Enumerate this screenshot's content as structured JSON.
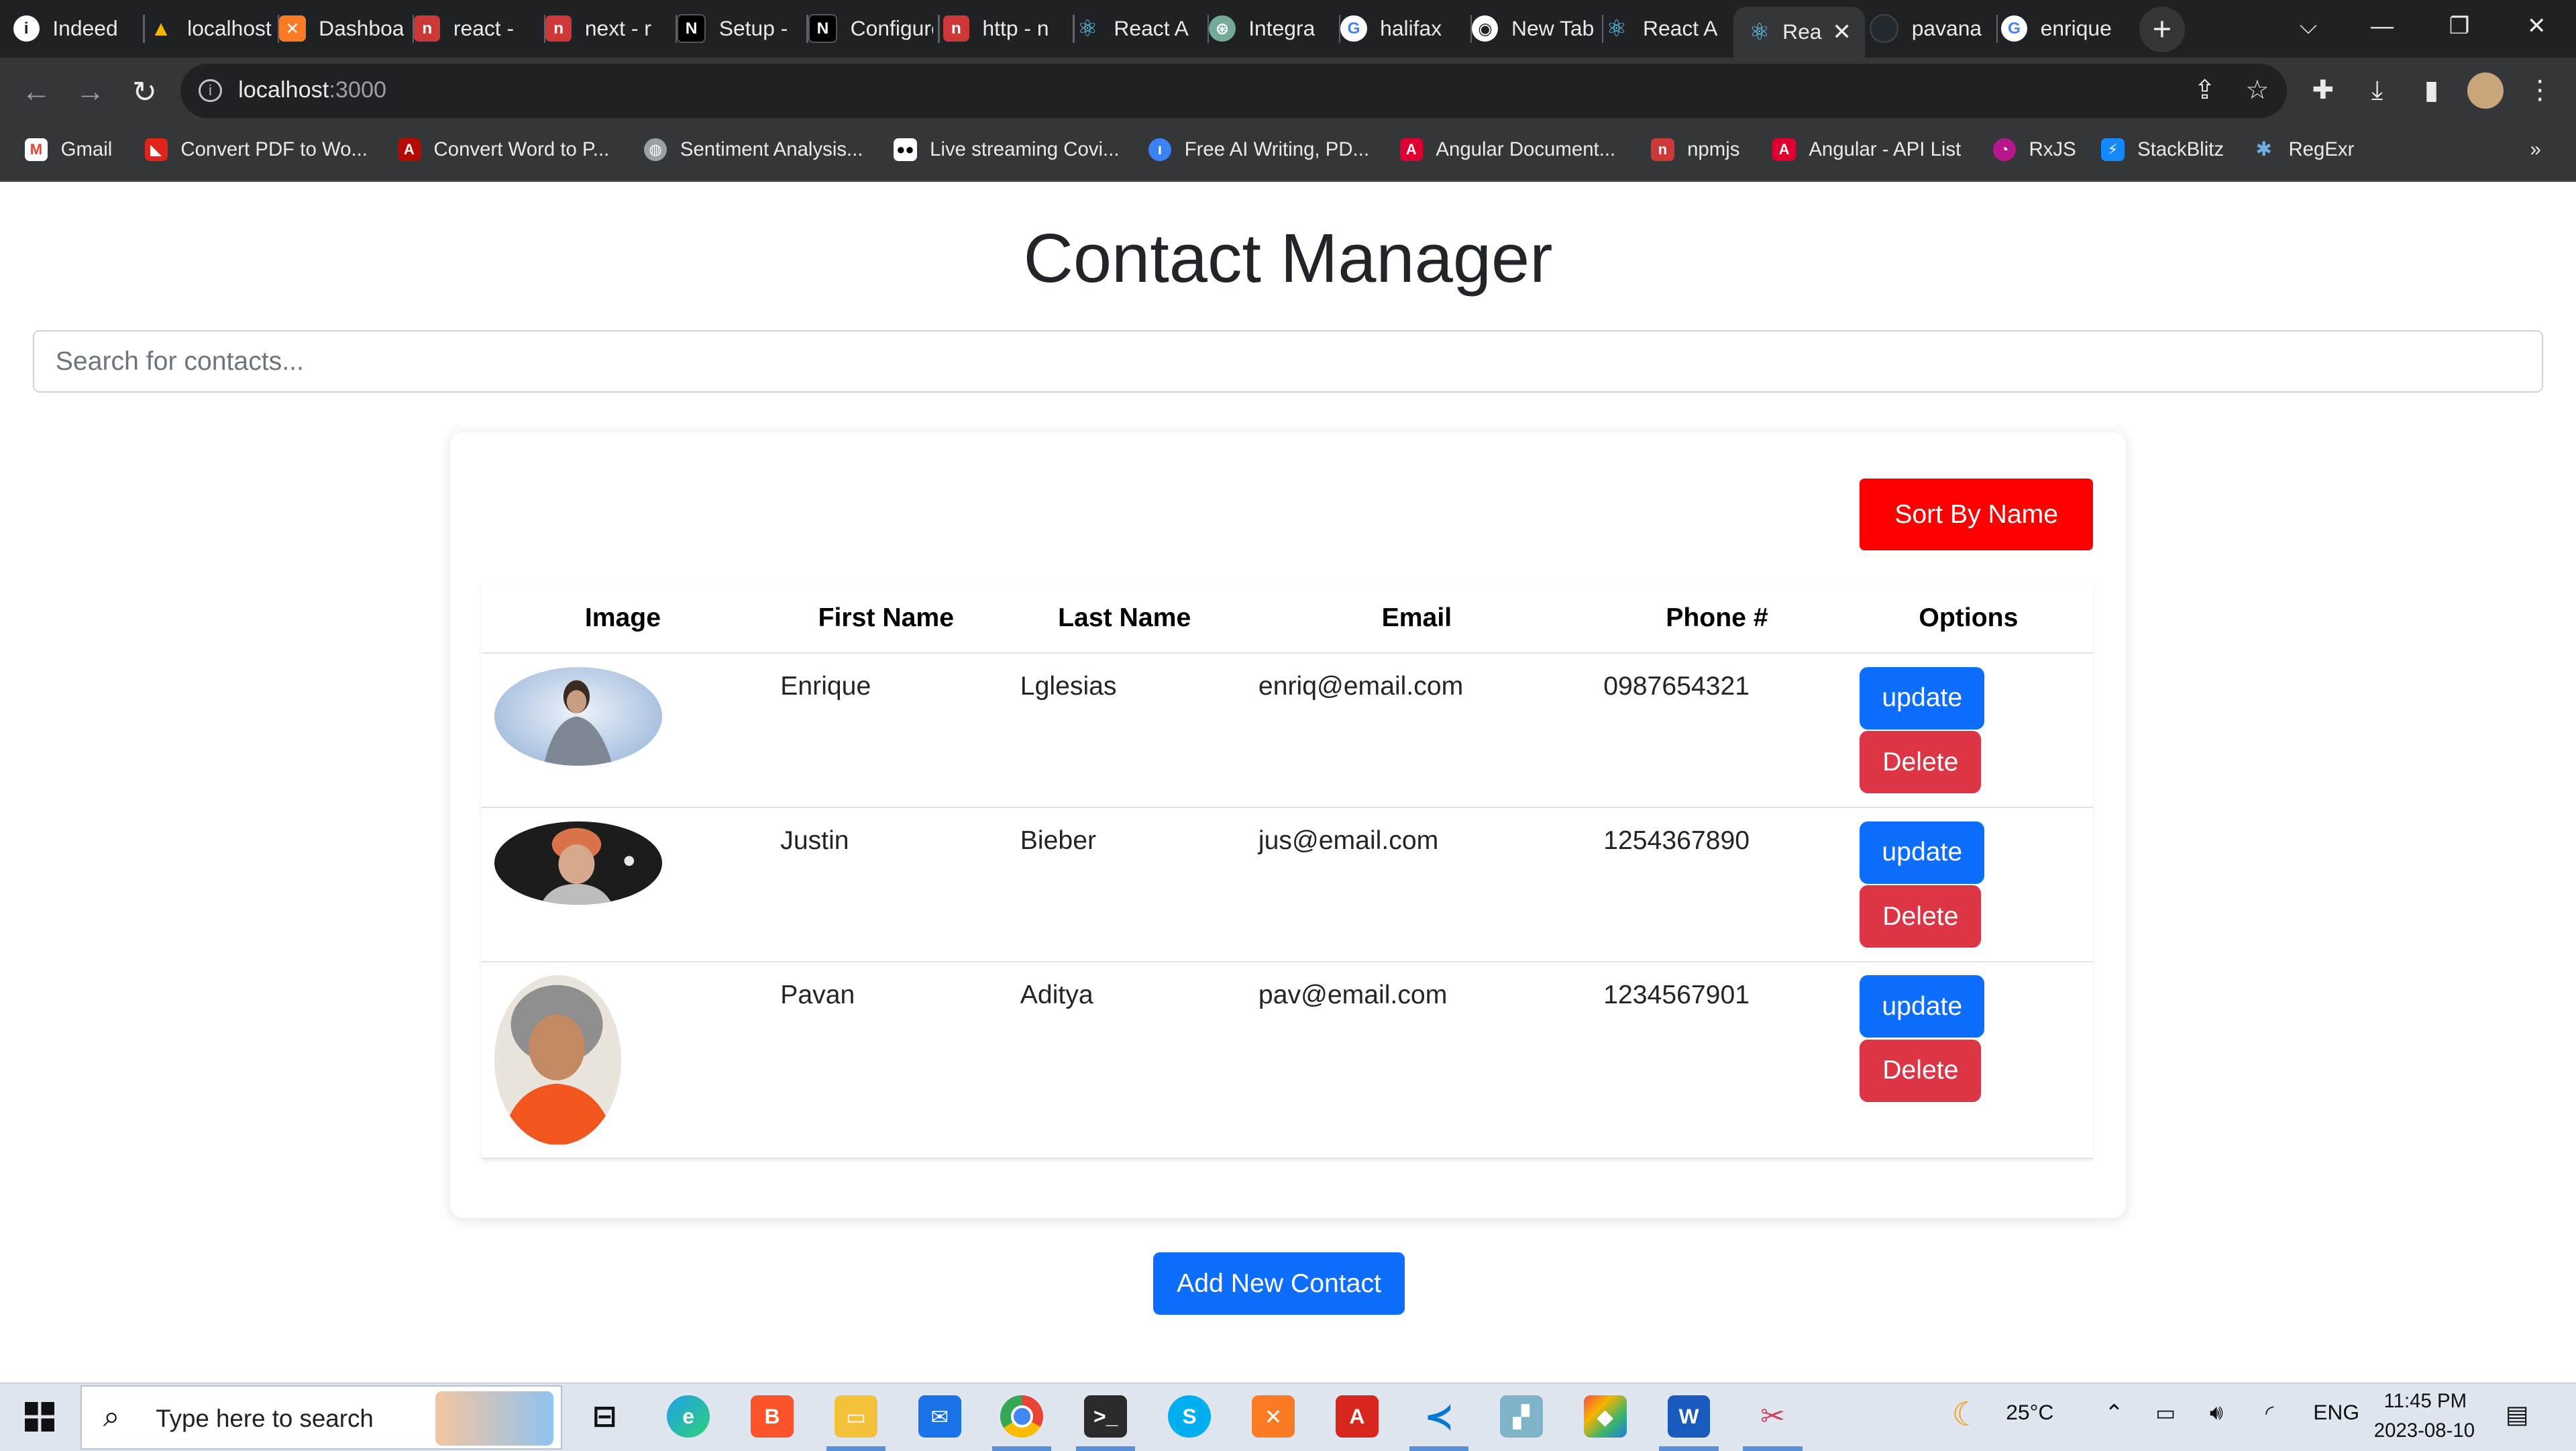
{
  "browser": {
    "tabs": [
      {
        "title": "Indeed",
        "icon": "info-icon",
        "color": "#ffffff"
      },
      {
        "title": "localhost",
        "icon": "laravel-icon",
        "color": "#f4b400"
      },
      {
        "title": "Dashboard",
        "icon": "xampp-icon",
        "color": "#fb7a24"
      },
      {
        "title": "react -",
        "icon": "npm-icon",
        "color": "#cb3837"
      },
      {
        "title": "next - r",
        "icon": "npm-icon",
        "color": "#cb3837"
      },
      {
        "title": "Setup -",
        "icon": "nextjs-icon",
        "color": "#000000"
      },
      {
        "title": "Configure",
        "icon": "nextjs-icon",
        "color": "#000000"
      },
      {
        "title": "http - n",
        "icon": "npm-icon",
        "color": "#cb3837"
      },
      {
        "title": "React A",
        "icon": "react-icon",
        "color": "#61dafb"
      },
      {
        "title": "Integra",
        "icon": "openai-icon",
        "color": "#74aa9c"
      },
      {
        "title": "halifax",
        "icon": "google-icon",
        "color": "#ffffff"
      },
      {
        "title": "New Tab",
        "icon": "chrome-icon",
        "color": "#ffffff"
      },
      {
        "title": "React A",
        "icon": "react-icon",
        "color": "#61dafb"
      },
      {
        "title": "Rea",
        "icon": "react-icon",
        "color": "#61dafb",
        "active": true
      },
      {
        "title": "pavana",
        "icon": "github-icon",
        "color": "#24292f"
      },
      {
        "title": "enrique",
        "icon": "google-icon",
        "color": "#ffffff"
      }
    ],
    "url_host": "localhost",
    "url_port": ":3000",
    "bookmarks": [
      {
        "label": "Gmail",
        "icon": "gmail-icon",
        "color": "#ea4335"
      },
      {
        "label": "Convert PDF to Wo...",
        "icon": "pdf-icon",
        "color": "#e2231a"
      },
      {
        "label": "Convert Word to P...",
        "icon": "acrobat-icon",
        "color": "#b30b00"
      },
      {
        "label": "Sentiment Analysis...",
        "icon": "globe-icon",
        "color": "#9aa0a6"
      },
      {
        "label": "Live streaming Covi...",
        "icon": "medium-icon",
        "color": "#000000"
      },
      {
        "label": "Free AI Writing, PD...",
        "icon": "ai-writer-icon",
        "color": "#3b82f6"
      },
      {
        "label": "Angular Document...",
        "icon": "angular-icon",
        "color": "#dd0031"
      },
      {
        "label": "npmjs",
        "icon": "npm-icon",
        "color": "#cb3837"
      },
      {
        "label": "Angular - API List",
        "icon": "angular-icon",
        "color": "#dd0031"
      },
      {
        "label": "RxJS",
        "icon": "rxjs-icon",
        "color": "#b7178c"
      },
      {
        "label": "StackBlitz",
        "icon": "stackblitz-icon",
        "color": "#1389fd"
      },
      {
        "label": "RegExr",
        "icon": "regexr-icon",
        "color": "#70b0e0"
      }
    ]
  },
  "app": {
    "title": "Contact Manager",
    "search_placeholder": "Search for contacts...",
    "sort_label": "Sort By Name",
    "add_label": "Add New Contact",
    "columns": [
      "Image",
      "First Name",
      "Last Name",
      "Email",
      "Phone #",
      "Options"
    ],
    "update_label": "update",
    "delete_label": "Delete",
    "contacts": [
      {
        "first": "Enrique",
        "last": "Lglesias",
        "email": "enriq@email.com",
        "phone": "0987654321"
      },
      {
        "first": "Justin",
        "last": "Bieber",
        "email": "jus@email.com",
        "phone": "1254367890"
      },
      {
        "first": "Pavan",
        "last": "Aditya",
        "email": "pav@email.com",
        "phone": "1234567901"
      }
    ]
  },
  "taskbar": {
    "search_placeholder": "Type here to search",
    "weather": "25°C",
    "language": "ENG",
    "time": "11:45 PM",
    "date": "2023-08-10"
  },
  "colors": {
    "primary": "#0d6efd",
    "danger": "#dc3545",
    "sort": "#ff0000"
  }
}
